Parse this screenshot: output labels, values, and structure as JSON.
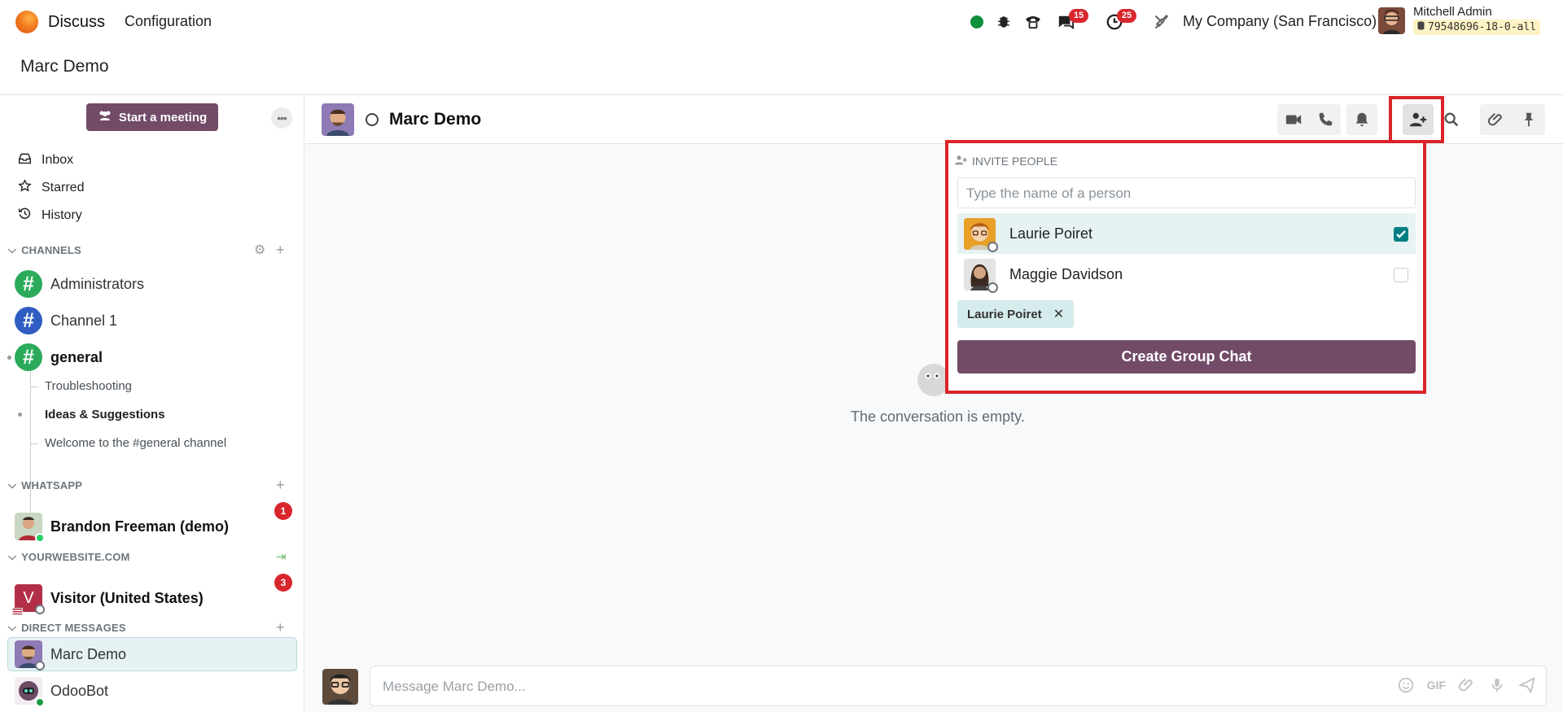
{
  "navbar": {
    "app_name": "Discuss",
    "menu_configuration": "Configuration",
    "chat_badge": "15",
    "activity_badge": "25",
    "company": "My Company (San Francisco)",
    "user_name": "Mitchell Admin",
    "db_name": "79548696-18-0-all"
  },
  "breadcrumb": {
    "title": "Marc Demo"
  },
  "sidebar": {
    "start_meeting": "Start a meeting",
    "mailboxes": [
      {
        "label": "Inbox",
        "icon": "inbox-icon"
      },
      {
        "label": "Starred",
        "icon": "star-icon"
      },
      {
        "label": "History",
        "icon": "history-icon"
      }
    ],
    "channels_header": "CHANNELS",
    "channels": [
      {
        "label": "Administrators",
        "color": "#2bab5a",
        "bold": false
      },
      {
        "label": "Channel 1",
        "color": "#2f5dc2",
        "bold": false
      },
      {
        "label": "general",
        "color": "#2bab5a",
        "bold": true
      }
    ],
    "sub_channels": [
      {
        "label": "Troubleshooting",
        "bold": false
      },
      {
        "label": "Ideas & Suggestions",
        "bold": true
      },
      {
        "label": "Welcome to the #general channel",
        "bold": false
      }
    ],
    "whatsapp_header": "WHATSAPP",
    "whatsapp_item": {
      "label": "Brandon Freeman (demo)",
      "counter": "1"
    },
    "website_header": "YOURWEBSITE.COM",
    "website_item": {
      "label": "Visitor (United States)",
      "counter": "3",
      "initial": "V"
    },
    "dm_header": "DIRECT MESSAGES",
    "dms": [
      {
        "label": "Marc Demo"
      },
      {
        "label": "OdooBot"
      }
    ]
  },
  "thread": {
    "name": "Marc Demo",
    "empty_text": "The conversation is empty.",
    "composer_placeholder": "Message Marc Demo...",
    "gif_label": "GIF"
  },
  "invite": {
    "title": "INVITE PEOPLE",
    "search_placeholder": "Type the name of a person",
    "people": [
      {
        "name": "Laurie Poiret",
        "checked": true
      },
      {
        "name": "Maggie Davidson",
        "checked": false
      }
    ],
    "selected_tag": "Laurie Poiret",
    "create_button": "Create Group Chat"
  },
  "colors": {
    "brand": "#714b67",
    "highlight": "#d9242a",
    "badge": "#d9262d",
    "teal": "#017e84"
  }
}
